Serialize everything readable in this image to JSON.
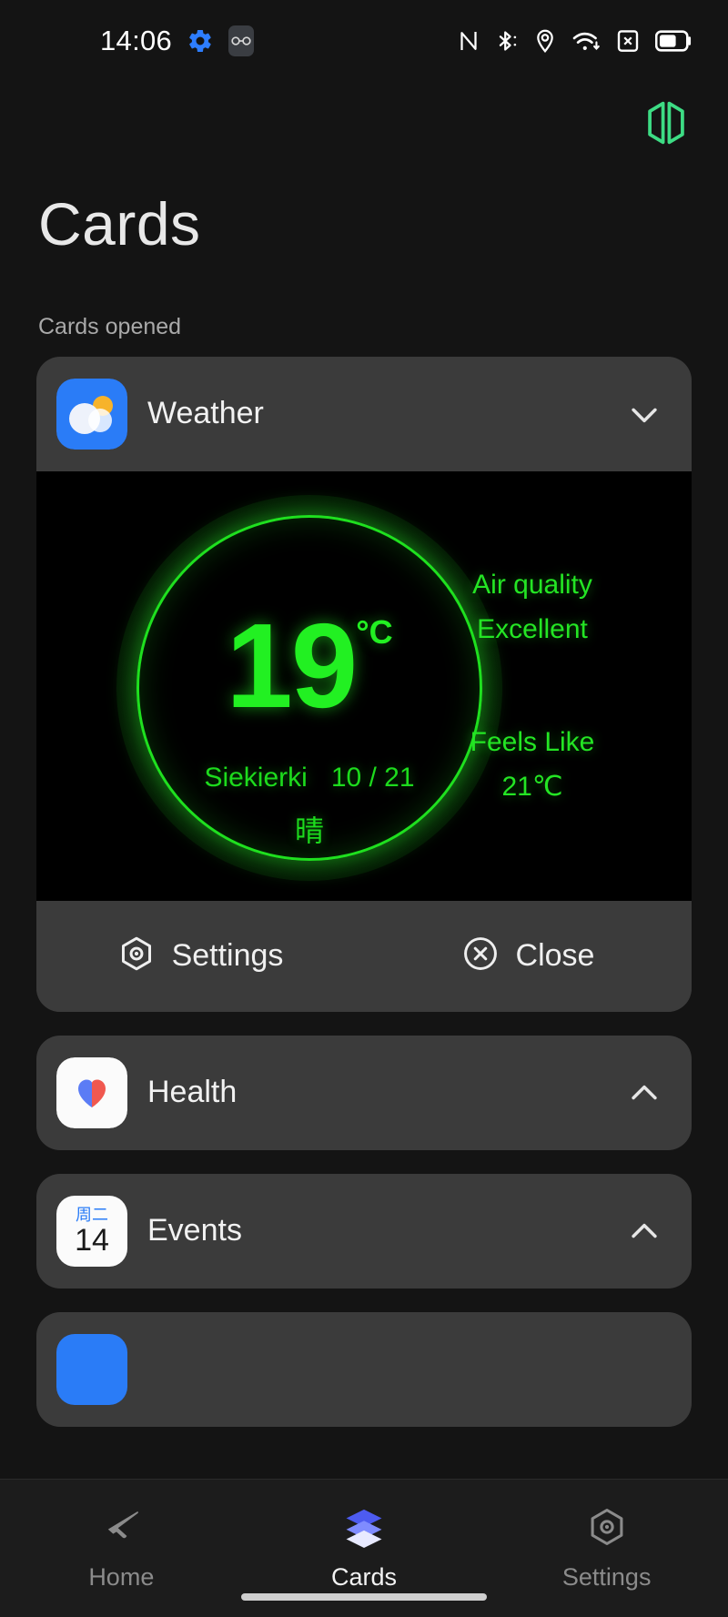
{
  "status_bar": {
    "time": "14:06",
    "left_icons": [
      "gear-icon",
      "glasses-icon"
    ],
    "right_icons": [
      "nfc-icon",
      "bluetooth-icon",
      "location-icon",
      "wifi-icon",
      "sim-off-icon",
      "battery-icon"
    ]
  },
  "app_bar": {
    "logo_icon": "cards-logo-icon",
    "logo_color": "#3ddc84"
  },
  "page": {
    "title": "Cards",
    "section_label": "Cards opened"
  },
  "cards": [
    {
      "id": "weather",
      "title": "Weather",
      "icon": "weather-app-icon",
      "expanded": true,
      "chevron": "chevron-down-icon",
      "widget": {
        "temperature": "19",
        "unit": "°C",
        "location": "Siekierki",
        "range": "10 / 21",
        "condition": "晴",
        "air_quality_label": "Air quality",
        "air_quality_value": "Excellent",
        "feels_like_label": "Feels Like",
        "feels_like_value": "21℃",
        "accent_color": "#22f022"
      },
      "actions": [
        {
          "label": "Settings",
          "icon": "settings-hexagon-icon"
        },
        {
          "label": "Close",
          "icon": "close-circle-icon"
        }
      ]
    },
    {
      "id": "health",
      "title": "Health",
      "icon": "health-app-icon",
      "expanded": false,
      "chevron": "chevron-up-icon"
    },
    {
      "id": "events",
      "title": "Events",
      "icon": "calendar-app-icon",
      "icon_weekday": "周二",
      "icon_day": "14",
      "expanded": false,
      "chevron": "chevron-up-icon"
    }
  ],
  "bottom_nav": {
    "items": [
      {
        "id": "home",
        "label": "Home",
        "icon": "home-arrow-icon",
        "active": false
      },
      {
        "id": "cards",
        "label": "Cards",
        "icon": "cards-stack-icon",
        "active": true
      },
      {
        "id": "settings",
        "label": "Settings",
        "icon": "settings-hexagon-icon",
        "active": false
      }
    ]
  }
}
